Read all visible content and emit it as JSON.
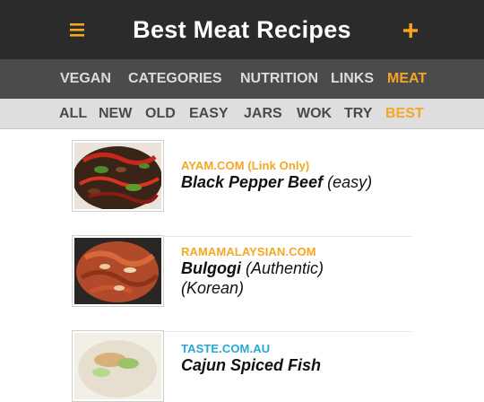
{
  "header": {
    "title": "Best Meat Recipes",
    "menu_icon": "hamburger-menu-icon",
    "add_icon": "plus-icon"
  },
  "nav_primary": [
    {
      "label": "VEGAN",
      "active": false
    },
    {
      "label": "CATEGORIES",
      "active": false
    },
    {
      "label": "NUTRITION",
      "active": false
    },
    {
      "label": "LINKS",
      "active": false
    },
    {
      "label": "MEAT",
      "active": true
    }
  ],
  "nav_secondary": [
    {
      "label": "ALL",
      "active": false
    },
    {
      "label": "NEW",
      "active": false
    },
    {
      "label": "OLD",
      "active": false
    },
    {
      "label": "EASY",
      "active": false
    },
    {
      "label": "JARS",
      "active": false
    },
    {
      "label": "WOK",
      "active": false
    },
    {
      "label": "TRY",
      "active": false
    },
    {
      "label": "BEST",
      "active": true
    }
  ],
  "recipes": [
    {
      "source": "AYAM.COM (Link Only)",
      "name": "Black Pepper Beef",
      "extra": "(easy)",
      "extra2": ""
    },
    {
      "source": "RAMAMALAYSIAN.COM",
      "name": "Bulgogi",
      "extra": "(Authentic)",
      "extra2": "(Korean)"
    },
    {
      "source": "TASTE.COM.AU",
      "name": "Cajun Spiced Fish",
      "extra": "",
      "extra2": ""
    }
  ],
  "colors": {
    "accent": "#f5a623",
    "link_blue": "#2aa6d6",
    "header_bg": "#2b2b2b",
    "nav_bg": "#4b4b4b",
    "subnav_bg": "#dedede"
  }
}
